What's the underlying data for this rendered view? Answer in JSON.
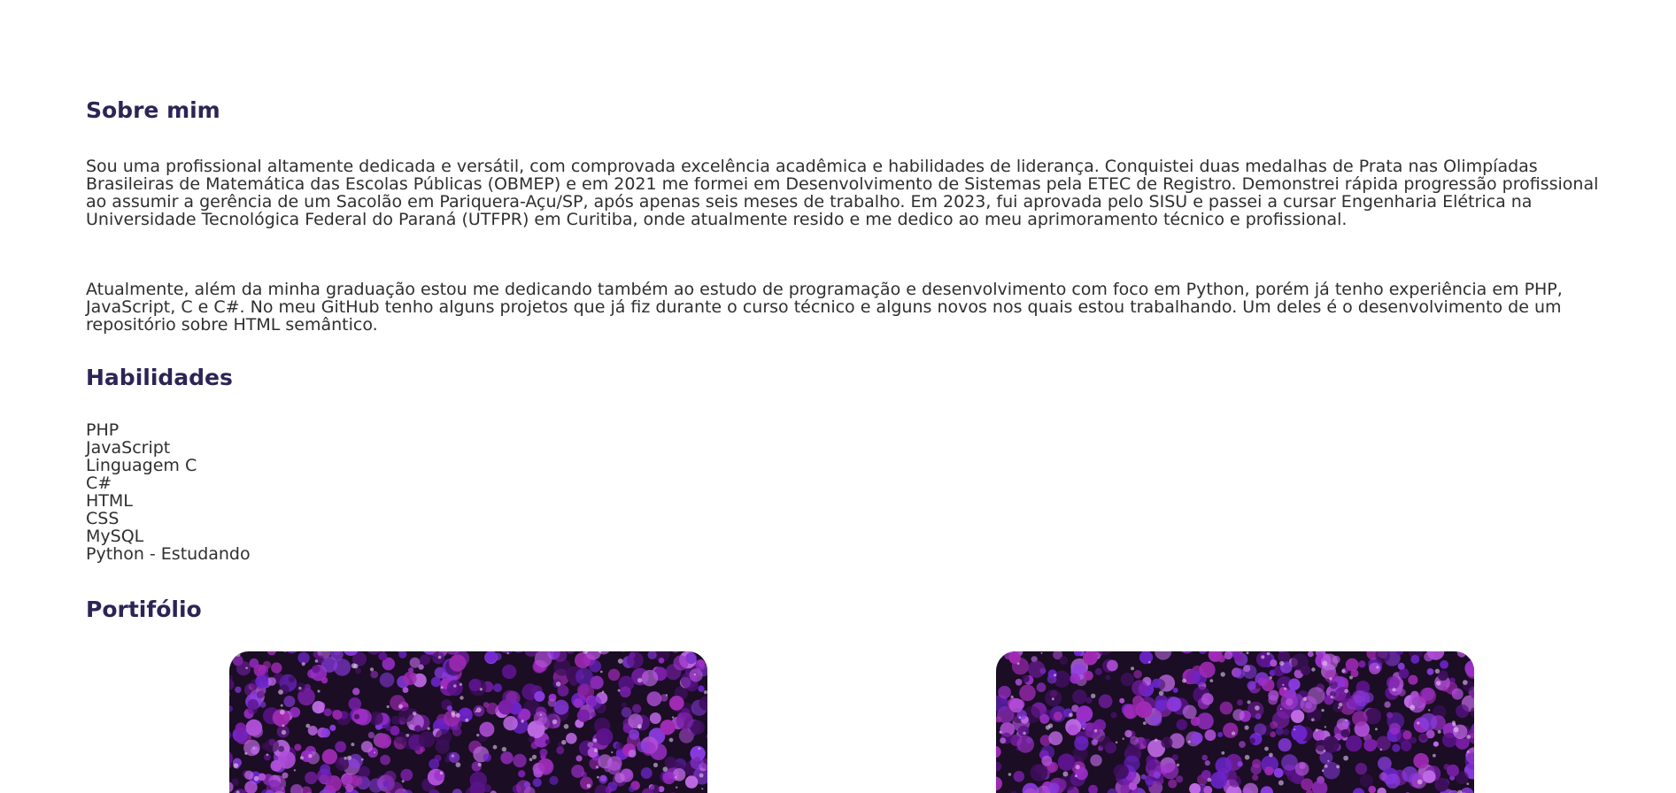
{
  "about": {
    "title": "Sobre mim",
    "paragraph1": "Sou uma profissional altamente dedicada e versátil, com comprovada excelência acadêmica e habilidades de liderança. Conquistei duas medalhas de Prata nas Olimpíadas Brasileiras de Matemática das Escolas Públicas (OBMEP) e em 2021 me formei em Desenvolvimento de Sistemas pela ETEC de Registro. Demonstrei rápida progressão profissional ao assumir a gerência de um Sacolão em Pariquera-Açu/SP, após apenas seis meses de trabalho. Em 2023, fui aprovada pelo SISU e passei a cursar Engenharia Elétrica na Universidade Tecnológica Federal do Paraná (UTFPR) em Curitiba, onde atualmente resido e me dedico ao meu aprimoramento técnico e profissional.",
    "paragraph2": "Atualmente, além da minha graduação estou me dedicando também ao estudo de programação e desenvolvimento com foco em Python, porém já tenho experiência em PHP, JavaScript, C e C#. No meu GitHub tenho alguns projetos que já fiz durante o curso técnico e alguns novos nos quais estou trabalhando. Um deles é o desenvolvimento de um repositório sobre HTML semântico."
  },
  "skills": {
    "title": "Habilidades",
    "items": [
      "PHP",
      "JavaScript",
      "Linguagem C",
      "C#",
      "HTML",
      "CSS",
      "MySQL",
      "Python - Estudando"
    ]
  },
  "portfolio": {
    "title": "Portifólio",
    "cards": [
      {
        "image": "purple-flowers-photo"
      },
      {
        "image": "purple-flowers-photo"
      }
    ]
  },
  "colors": {
    "heading": "#2d2456",
    "text": "#2f2f2f",
    "background": "#ffffff"
  }
}
